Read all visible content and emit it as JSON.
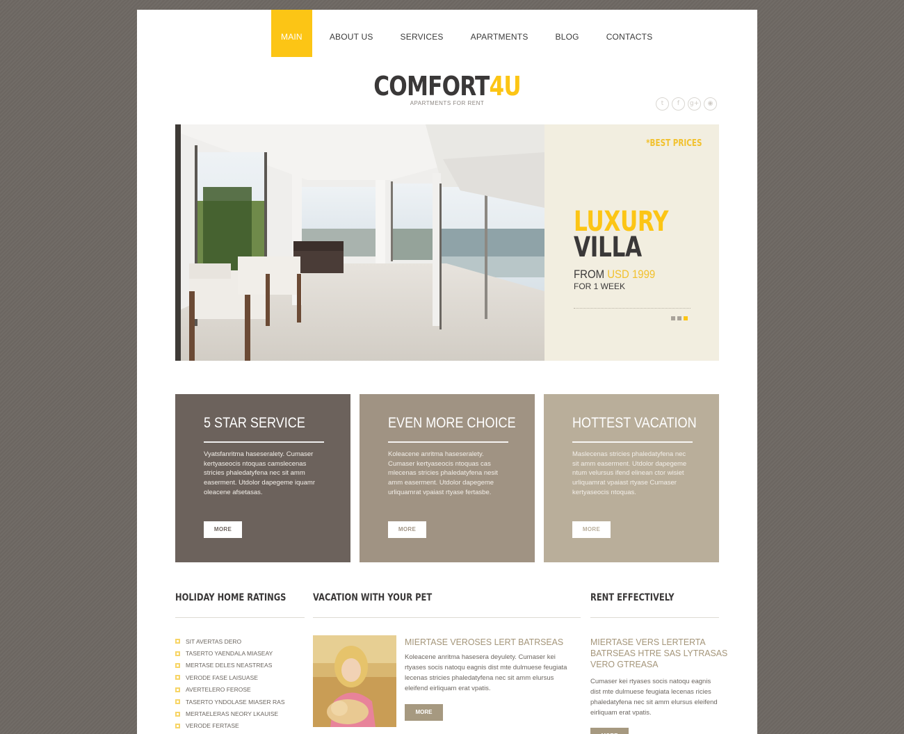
{
  "nav": {
    "items": [
      {
        "label": "MAIN",
        "active": true
      },
      {
        "label": "ABOUT US",
        "active": false
      },
      {
        "label": "SERVICES",
        "active": false
      },
      {
        "label": "APARTMENTS",
        "active": false
      },
      {
        "label": "BLOG",
        "active": false
      },
      {
        "label": "CONTACTS",
        "active": false
      }
    ]
  },
  "logo": {
    "name_main": "COMFORT",
    "name_accent": "4U",
    "tagline": "APARTMENTS FOR RENT"
  },
  "social": [
    {
      "icon": "twitter-icon",
      "glyph": "t"
    },
    {
      "icon": "facebook-icon",
      "glyph": "f"
    },
    {
      "icon": "google-plus-icon",
      "glyph": "g+"
    },
    {
      "icon": "rss-icon",
      "glyph": "◉"
    }
  ],
  "hero": {
    "badge": "*BEST PRICES",
    "title_line1": "LUXURY",
    "title_line2": "VILLA",
    "price_prefix": "FROM ",
    "price_value": "USD 1999",
    "period": "FOR 1 WEEK",
    "slides": 3,
    "active_slide": 3
  },
  "features": [
    {
      "title": "5 STAR SERVICE",
      "text": "Vyatsfanritma haseseralety. Cumaser kertyaseocis ntoquas camslecenas stricies phaledatyfena nec sit amm easerment. Utdolor dapegeme iquamr oleacene afsetasas.",
      "button": "MORE",
      "color": "#6c625c"
    },
    {
      "title": "EVEN MORE CHOICE",
      "text": "Koleacene anritma haseseralety. Cumaser kertyaseocis ntoquas cas mlecenas stricies phaledatyfena nesit amm easerment. Utdolor dapegeme urliquamrat vpaiast rtyase fertasbe.",
      "button": "MORE",
      "color": "#a09383"
    },
    {
      "title": "HOTTEST VACATION",
      "text": "Maslecenas stricies phaledatyfena nec sit amm easerment. Utdolor dapegeme ntum velursus ifend elinean ctor wisiet urliquamrat vpaiast rtyase Cumaser kertyaseocis ntoquas.",
      "button": "MORE",
      "color": "#b9ae9a"
    }
  ],
  "ratings": {
    "title": "HOLIDAY HOME RATINGS",
    "items": [
      "SIT AVERTAS DERO",
      "TASERTO YAENDALA MIASEAY",
      "MERTASE DELES NEASTREAS",
      "VERODE FASE LAISUASE",
      "AVERTELERO FEROSE",
      "TASERTO YNDOLASE MIASER RAS",
      "MERTAELERAS NEORY LKAUISE",
      "VERODE FERTASE"
    ]
  },
  "pet": {
    "title": "VACATION WITH YOUR PET",
    "article_title": "MIERTASE VEROSES LERT BATRSEAS",
    "article_text": "Koleacene anritma hasesera deyulety. Cumaser kei rtyases socis natoqu eagnis dist mte dulmuese feugiata lecenas stricies phaledatyfena nec sit amm elursus eleifend eirliquam erat vpatis.",
    "button": "MORE"
  },
  "rent": {
    "title": "RENT EFFECTIVELY",
    "article_title_lines": [
      "MIERTASE VERS LERTERTA",
      "BATRSEAS HTRE SAS LYTRASAS",
      "VERO GTREASA"
    ],
    "article_text": "Cumaser kei rtyases socis natoqu eagnis dist mte dulmuese feugiata lecenas ricies phaledatyfena nec sit amm elursus eleifend eirliquam erat vpatis.",
    "button": "MORE"
  },
  "colors": {
    "accent": "#fcc515",
    "background": "#6e6863",
    "dark_text": "#3a3838",
    "heading_tan": "#a49579"
  }
}
